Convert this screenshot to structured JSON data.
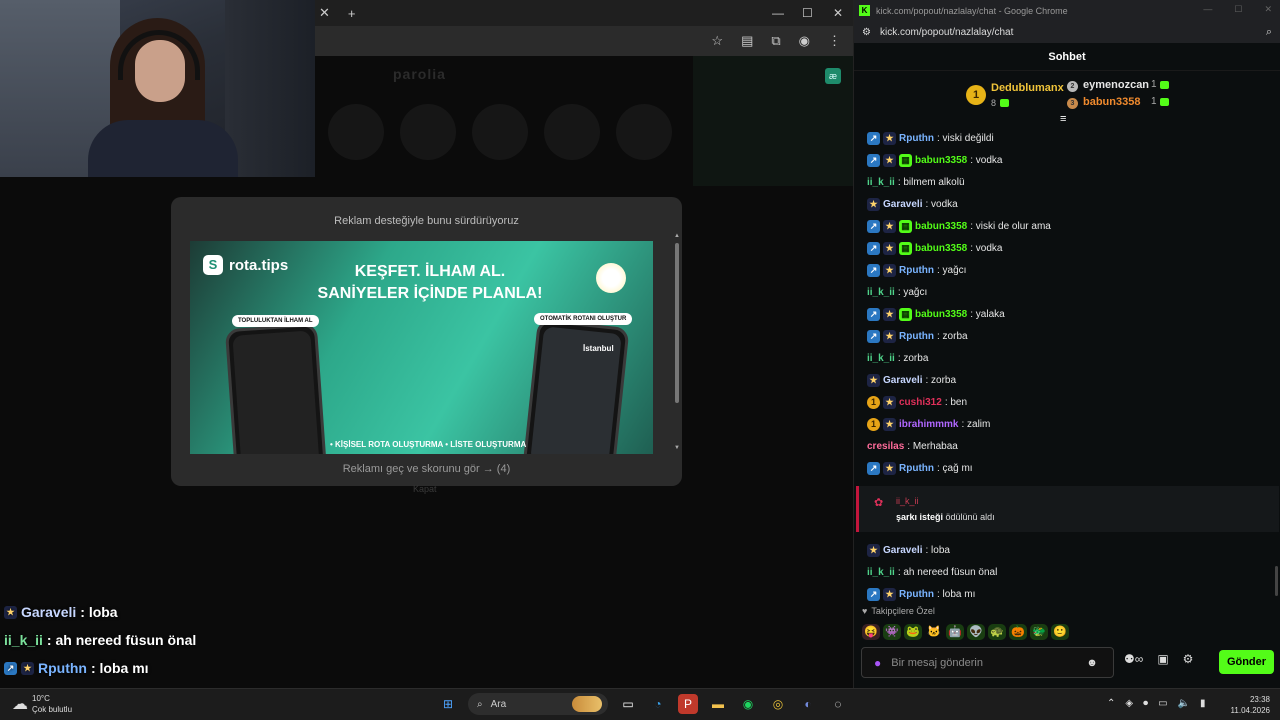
{
  "left_browser": {
    "new_tab_icon": "plus-icon",
    "brand": "parolia",
    "extension_badge": "æ"
  },
  "ad": {
    "title": "Reklam desteğiyle bunu sürdürüyoruz",
    "logo_text": "rota.tips",
    "headline_1": "KEŞFET. İLHAM AL.",
    "headline_2": "SANİYELER İÇİNDE PLANLA!",
    "pill_left": "TOPLULUKTAN İLHAM AL",
    "pill_right": "OTOMATİK ROTANI OLUŞTUR",
    "phone_right_city": "İstanbul",
    "bottom_text": "• KİŞİSEL ROTA OLUŞTURMA • LİSTE OLUŞTURMA",
    "skip_text": "Reklamı geç ve skorunu gör → (4)",
    "behind_close": "Kapat"
  },
  "overlay_chat": [
    {
      "user": "Garaveli",
      "text": ": loba",
      "color": "#c7d7ff",
      "badges": [
        "star"
      ]
    },
    {
      "user": "ii_k_ii",
      "text": ": ah nereed füsun önal",
      "color": "#7be09b",
      "badges": []
    },
    {
      "user": "Rputhn",
      "text": ": loba mı",
      "color": "#7ab4ff",
      "badges": [
        "arrow",
        "star"
      ]
    }
  ],
  "chat_window": {
    "title": "kick.com/popout/nazlalay/chat - Google Chrome",
    "url": "kick.com/popout/nazlalay/chat",
    "header": "Sohbet",
    "leaderboard": {
      "first": {
        "rank": "1",
        "name": "Dedublumanx",
        "count": "8"
      },
      "second": {
        "name": "eymenozcan",
        "count": "1"
      },
      "third": {
        "name": "babun3358",
        "count": "1"
      }
    },
    "messages": [
      {
        "user": "Rputhn",
        "text": ": viski değildi",
        "color": "#7ab4ff",
        "badges": [
          "arrow",
          "star"
        ]
      },
      {
        "user": "babun3358",
        "text": ": vodka",
        "color": "#53fc18",
        "badges": [
          "arrow",
          "star",
          "green"
        ]
      },
      {
        "user": "ii_k_ii",
        "text": ": bilmem alkolü",
        "color": "#4fd38a",
        "badges": []
      },
      {
        "user": "Garaveli",
        "text": ": vodka",
        "color": "#c7d7ff",
        "badges": [
          "star"
        ]
      },
      {
        "user": "babun3358",
        "text": ": viski de olur ama",
        "color": "#53fc18",
        "badges": [
          "arrow",
          "star",
          "green"
        ]
      },
      {
        "user": "babun3358",
        "text": ": vodka",
        "color": "#53fc18",
        "badges": [
          "arrow",
          "star",
          "green"
        ]
      },
      {
        "user": "Rputhn",
        "text": ": yağcı",
        "color": "#7ab4ff",
        "badges": [
          "arrow",
          "star"
        ]
      },
      {
        "user": "ii_k_ii",
        "text": ": yağcı",
        "color": "#4fd38a",
        "badges": []
      },
      {
        "user": "babun3358",
        "text": ": yalaka",
        "color": "#53fc18",
        "badges": [
          "arrow",
          "star",
          "green"
        ]
      },
      {
        "user": "Rputhn",
        "text": ": zorba",
        "color": "#7ab4ff",
        "badges": [
          "arrow",
          "star"
        ]
      },
      {
        "user": "ii_k_ii",
        "text": ": zorba",
        "color": "#4fd38a",
        "badges": []
      },
      {
        "user": "Garaveli",
        "text": ": zorba",
        "color": "#c7d7ff",
        "badges": [
          "star"
        ]
      },
      {
        "user": "cushi312",
        "text": ": ben",
        "color": "#e0305a",
        "badges": [
          "coin",
          "star"
        ]
      },
      {
        "user": "ibrahimmmk",
        "text": ": zalim",
        "color": "#b067ff",
        "badges": [
          "coin",
          "star"
        ]
      },
      {
        "user": "cresilas",
        "text": ": Merhabaa",
        "color": "#ff6b9a",
        "badges": []
      },
      {
        "user": "Rputhn",
        "text": ": çağ mı",
        "color": "#7ab4ff",
        "badges": [
          "arrow",
          "star"
        ]
      }
    ],
    "reward": {
      "user": "ii_k_ii",
      "reward_name": "şarkı isteği",
      "suffix": " ödülünü aldı"
    },
    "messages_after": [
      {
        "user": "Garaveli",
        "text": ": loba",
        "color": "#c7d7ff",
        "badges": [
          "star"
        ]
      },
      {
        "user": "ii_k_ii",
        "text": ": ah nereed füsun önal",
        "color": "#4fd38a",
        "badges": []
      },
      {
        "user": "Rputhn",
        "text": ": loba mı",
        "color": "#7ab4ff",
        "badges": [
          "arrow",
          "star"
        ]
      }
    ],
    "followers_label": "Takipçilere Özel",
    "emotes": [
      "😝",
      "👾",
      "🐸",
      "🐱",
      "🤖",
      "👽",
      "🐢",
      "🎃",
      "🐲",
      "🙂"
    ],
    "composer_placeholder": "Bir mesaj gönderin",
    "send_label": "Gönder"
  },
  "taskbar": {
    "temperature": "10°C",
    "weather": "Çok bulutlu",
    "search_label": "Ara",
    "time": "23:38",
    "date": "11.04.2026"
  },
  "colors": {
    "kick_green": "#53fc18",
    "ad_teal": "#2da88a",
    "reward_red": "#c3163c"
  }
}
